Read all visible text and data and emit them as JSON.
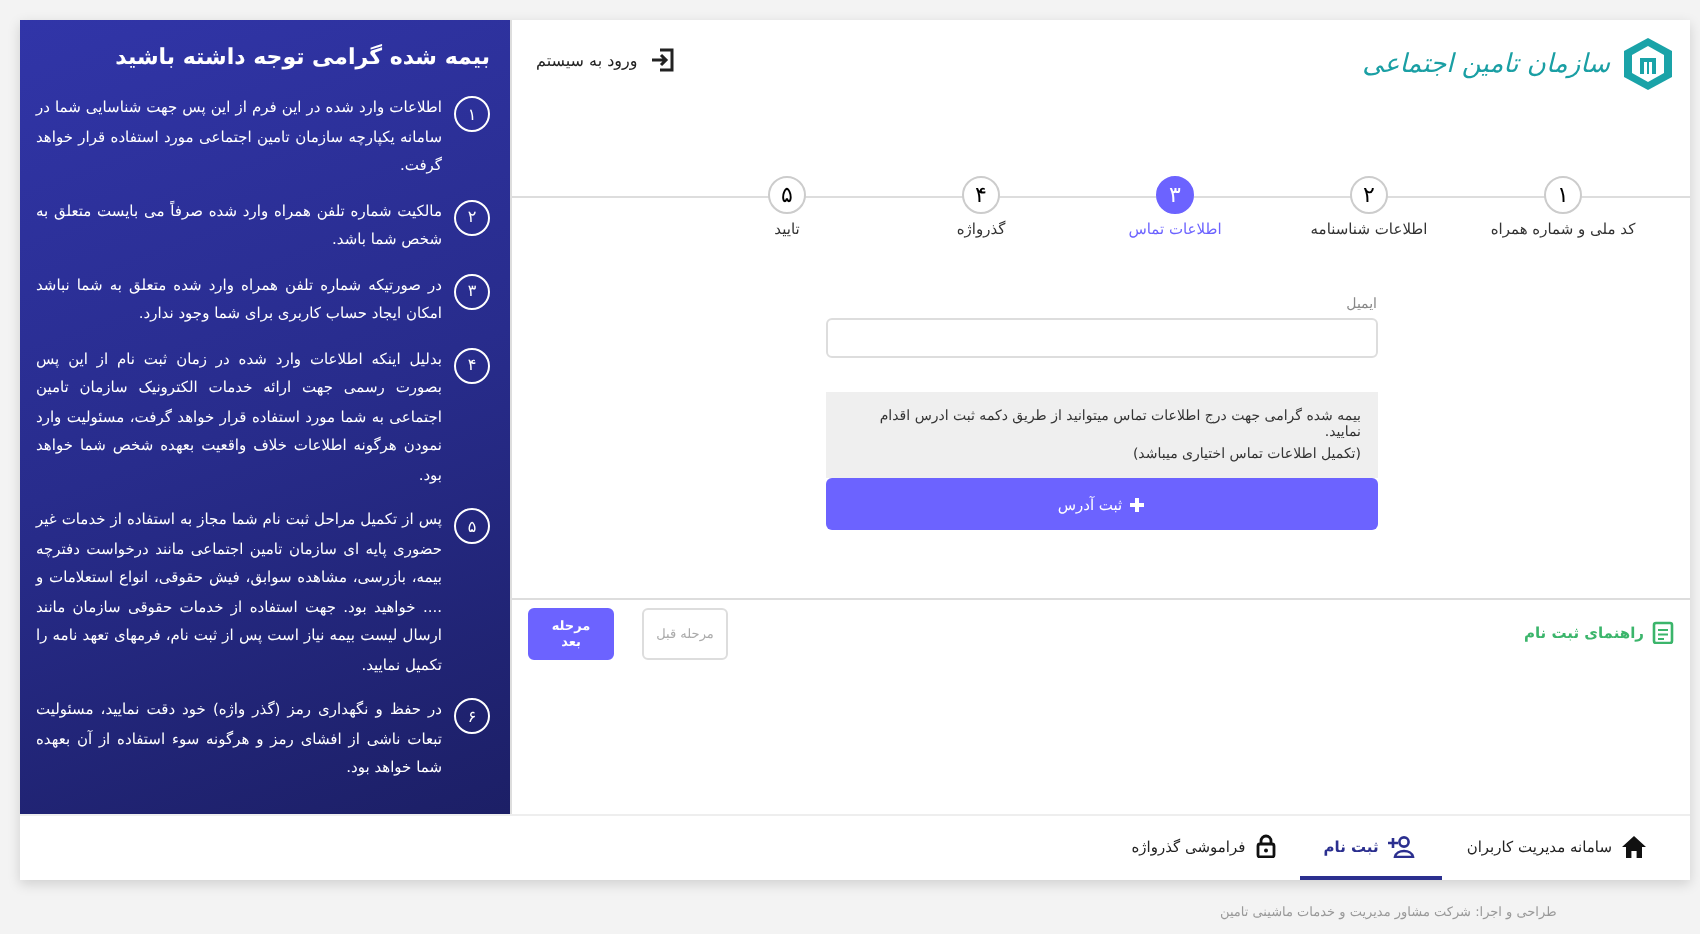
{
  "header": {
    "logo_text": "سازمان تامین اجتماعی",
    "login_link": "ورود به سیستم"
  },
  "steps": [
    {
      "number": "۱",
      "label": "کد ملی و شماره همراه",
      "selected": false
    },
    {
      "number": "۲",
      "label": "اطلاعات شناسنامه",
      "selected": false
    },
    {
      "number": "۳",
      "label": "اطلاعات تماس",
      "selected": true
    },
    {
      "number": "۴",
      "label": "گذرواژه",
      "selected": false
    },
    {
      "number": "۵",
      "label": "تایید",
      "selected": false
    }
  ],
  "email_field": {
    "label": "ایمیل"
  },
  "notice": [
    "بیمه شده گرامی جهت درج اطلاعات تماس میتوانید از طریق دکمه ثبت ادرس اقدام نمایید.",
    "(تکمیل اطلاعات تماس اختیاری میباشد)"
  ],
  "add_address_button": "ثبت آدرس",
  "guide_link": "راهنمای ثبت نام",
  "nav_buttons": [
    {
      "label": "مرحله قبل",
      "disabled": true
    },
    {
      "label": "مرحله بعد",
      "disabled": false
    }
  ],
  "panel": {
    "title": "بیمه شده گرامی توجه داشته باشید",
    "items": [
      {
        "number": "۱",
        "text": "اطلاعات وارد شده در این فرم از این پس جهت شناسایی شما در سامانه یکپارچه سازمان تامین اجتماعی مورد استفاده قرار خواهد گرفت."
      },
      {
        "number": "۲",
        "text": "مالکیت شماره تلفن همراه وارد شده صرفاً می بایست متعلق به شخص شما باشد."
      },
      {
        "number": "۳",
        "text": "در صورتیکه شماره تلفن همراه وارد شده متعلق به شما نباشد امکان ایجاد حساب کاربری برای شما وجود ندارد."
      },
      {
        "number": "۴",
        "text": "بدلیل اینکه اطلاعات وارد شده در زمان ثبت نام از این پس بصورت رسمی جهت ارائه خدمات الکترونیک سازمان تامین اجتماعی به شما مورد استفاده قرار خواهد گرفت، مسئولیت وارد نمودن هرگونه اطلاعات خلاف واقعیت بعهده شخص شما خواهد بود."
      },
      {
        "number": "۵",
        "text": "پس از تکمیل مراحل ثبت نام شما مجاز به استفاده از خدمات غیر حضوری پایه ای سازمان تامین اجتماعی مانند درخواست دفترچه بیمه، بازرسی، مشاهده سوابق، فیش حقوقی، انواع استعلامات و .... خواهید بود. جهت استفاده از خدمات حقوقی سازمان مانند ارسال لیست بیمه نیاز است پس از ثبت نام، فرمهای تعهد نامه را تکمیل نمایید."
      },
      {
        "number": "۶",
        "text": "در حفظ و نگهداری رمز (گذر واژه) خود دقت نمایید، مسئولیت تبعات ناشی از افشای رمز و هرگونه سوء استفاده از آن بعهده شما خواهد بود."
      }
    ]
  },
  "bottom_nav": [
    {
      "label": "سامانه مدیریت کاربران",
      "kind": "home",
      "selected": false
    },
    {
      "label": "ثبت نام",
      "kind": "register",
      "selected": true
    },
    {
      "label": "فراموشی گذرواژه",
      "kind": "lock",
      "selected": false
    }
  ],
  "footer": "طراحی و اجرا: شرکت مشاور مدیریت و خدمات ماشینی تامین"
}
